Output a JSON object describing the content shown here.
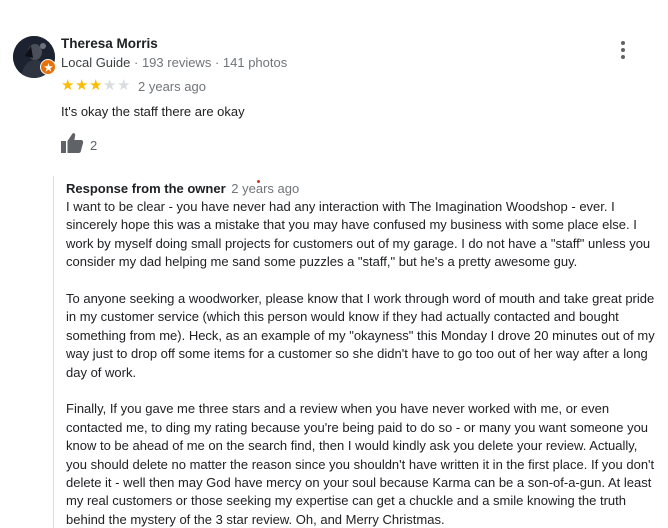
{
  "reviewer": {
    "name": "Theresa Morris",
    "badge": "Local Guide",
    "separator": " · ",
    "reviews": "193 reviews",
    "photos": "141 photos"
  },
  "review": {
    "rating": 3,
    "max_rating": 5,
    "date": "2 years ago",
    "text": "It's okay the staff there are okay",
    "likes": "2"
  },
  "owner_response": {
    "title": "Response from the owner",
    "date": "2 years ago",
    "paragraphs": [
      "I want to be clear - you have never had any interaction with The Imagination Woodshop - ever. I sincerely hope this was a mistake that you may have confused my business with some place else. I work by myself doing small projects for customers out of my garage. I do not have a \"staff\" unless you consider my dad helping me sand some puzzles a \"staff,\" but he's a pretty awesome guy.",
      "To anyone seeking a woodworker, please know that I work through word of mouth and take great pride in my customer service (which this person would know if they had actually contacted and bought something from me). Heck, as an example of my \"okayness\" this Monday I drove 20 minutes out of my way just to drop off some items for a customer so she didn't have to go too out of her way after a long day of work.",
      "Finally, If you gave me three stars and a review when you have never worked with me, or even contacted me, to ding my rating because you're being paid to do so - or many you want someone you know to be ahead of me on the search find, then I would kindly ask you delete your review. Actually, you should delete no matter the reason since you shouldn't have written it in the first place. If you don't delete it - well then may God have mercy on your soul because Karma can be a son-of-a-gun. At least my real customers or those seeking my expertise can get a chuckle and a smile knowing the truth behind the mystery of the 3 star review. Oh, and Merry Christmas."
    ]
  },
  "icons": {
    "avatar": "avatar",
    "badge": "local-guide-badge-icon",
    "more": "more-vert-icon",
    "like": "thumb-up-icon",
    "star": "star-icon"
  },
  "colors": {
    "star_on": "#fbbc04",
    "star_off": "#dadce0",
    "badge": "#e8710a",
    "meta_text": "#70757a"
  }
}
